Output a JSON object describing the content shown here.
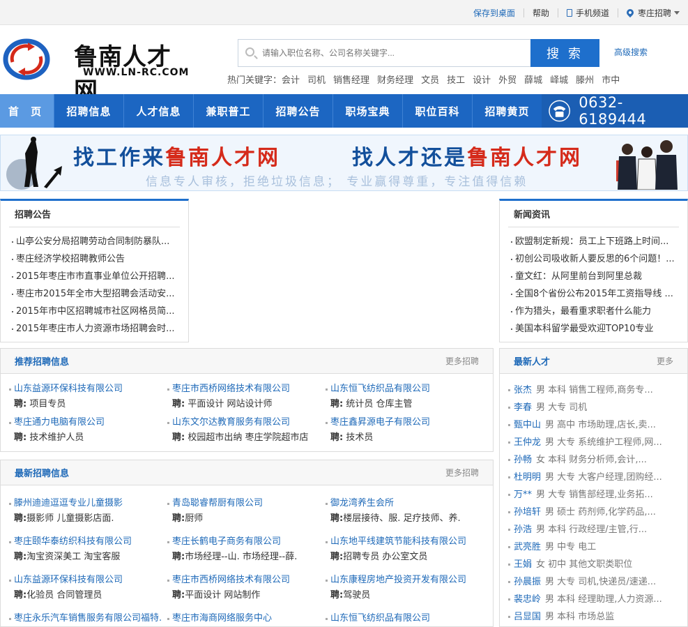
{
  "topbar": {
    "save": "保存到桌面",
    "help": "帮助",
    "mobile": "手机频道",
    "city": "枣庄招聘"
  },
  "logo": {
    "name": "鲁南人才网",
    "url": "WWW.LN-RC.COM"
  },
  "search": {
    "placeholder": "请输入职位名称、公司名称关键字...",
    "button": "搜 索",
    "advanced": "高级搜索"
  },
  "hot": {
    "label": "热门关键字：",
    "keywords": [
      "会计",
      "司机",
      "销售经理",
      "财务经理",
      "文员",
      "技工",
      "设计",
      "外贸",
      "薛城",
      "峄城",
      "滕州",
      "市中"
    ]
  },
  "nav": {
    "items": [
      "首 页",
      "招聘信息",
      "人才信息",
      "兼职普工",
      "招聘公告",
      "职场宝典",
      "职位百科",
      "招聘黄页"
    ],
    "phone": "0632-6189444"
  },
  "banner": {
    "left_a": "找工作来",
    "left_b": "鲁南人才网",
    "right_a": "找人才还是",
    "right_b": "鲁南人才网",
    "sub": "信息专人审核，拒绝垃圾信息；  专业赢得尊重，专注值得信赖"
  },
  "announce": {
    "title": "招聘公告",
    "items": [
      "山亭公安分局招聘劳动合同制防暴队...",
      "枣庄经济学校招聘教师公告",
      "2015年枣庄市市直事业单位公开招聘...",
      "枣庄市2015年全市大型招聘会活动安...",
      "2015年市中区招聘城市社区网格员简...",
      "2015年枣庄市人力资源市场招聘会时..."
    ]
  },
  "news": {
    "title": "新闻资讯",
    "items": [
      "欧盟制定新规：员工上下班路上时间...",
      "初创公司吸收新人要反思的6个问题！...",
      "童文红：从阿里前台到阿里总裁",
      "全国8个省份公布2015年工资指导线 ...",
      "作为猎头，最看重求职者什么能力",
      "美国本科留学最受欢迎TOP10专业"
    ]
  },
  "recommend": {
    "title": "推荐招聘信息",
    "more": "更多招聘",
    "jobs": [
      {
        "company": "山东益源环保科技有限公司",
        "label": "聘:",
        "positions": " 项目专员"
      },
      {
        "company": "枣庄市西桥网络技术有限公司",
        "label": "聘:",
        "positions": " 平面设计  网站设计师"
      },
      {
        "company": "山东恒飞纺织品有限公司",
        "label": "聘:",
        "positions": " 统计员  仓库主管"
      },
      {
        "company": "枣庄通力电脑有限公司",
        "label": "聘:",
        "positions": " 技术维护人员"
      },
      {
        "company": "山东文尔达教育服务有限公司",
        "label": "聘:",
        "positions": " 校园超市出纳  枣庄学院超市店"
      },
      {
        "company": "枣庄鑫昇源电子有限公司",
        "label": "聘:",
        "positions": " 技术员"
      }
    ]
  },
  "latest": {
    "title": "最新招聘信息",
    "more": "更多招聘",
    "jobs": [
      {
        "company": "滕州迪迪逗逗专业儿童摄影",
        "label": "聘:",
        "positions": "摄影师  儿童摄影店面."
      },
      {
        "company": "青岛聪睿帮厨有限公司",
        "label": "聘:",
        "positions": "厨师"
      },
      {
        "company": "御龙湾养生会所",
        "label": "聘:",
        "positions": "楼层接待、服.  足疗技师、养."
      },
      {
        "company": "枣庄颐华泰纺织科技有限公司",
        "label": "聘:",
        "positions": "淘宝资深美工  淘宝客服"
      },
      {
        "company": "枣庄长鹤电子商务有限公司",
        "label": "聘:",
        "positions": "市场经理--山.  市场经理--薛."
      },
      {
        "company": "山东地平线建筑节能科技有限公司",
        "label": "聘:",
        "positions": "招聘专员  办公室文员"
      },
      {
        "company": "山东益源环保科技有限公司",
        "label": "聘:",
        "positions": "化验员  合同管理员"
      },
      {
        "company": "枣庄市西桥网络技术有限公司",
        "label": "聘:",
        "positions": "平面设计  网站制作"
      },
      {
        "company": "山东康程房地产投资开发有限公司",
        "label": "聘:",
        "positions": "驾驶员"
      },
      {
        "company": "枣庄永乐汽车销售服务有限公司福特.",
        "label": "",
        "positions": ""
      },
      {
        "company": "枣庄市海商网络服务中心",
        "label": "",
        "positions": ""
      },
      {
        "company": "山东恒飞纺织品有限公司",
        "label": "",
        "positions": ""
      }
    ]
  },
  "talent": {
    "title": "最新人才",
    "more": "更多",
    "items": [
      {
        "name": "张杰",
        "meta": "男 本科 销售工程师,商务专..."
      },
      {
        "name": "李春",
        "meta": "男 大专 司机"
      },
      {
        "name": "甄中山",
        "meta": "男 高中 市场助理,店长,卖..."
      },
      {
        "name": "王仲龙",
        "meta": "男 大专 系统维护工程师,网..."
      },
      {
        "name": "孙畅",
        "meta": "女 本科 财务分析师,会计,..."
      },
      {
        "name": "杜明明",
        "meta": "男 大专 大客户经理,团购经..."
      },
      {
        "name": "万**",
        "meta": "男 大专 销售部经理,业务拓..."
      },
      {
        "name": "孙培轩",
        "meta": "男 硕士 药剂师,化学药品,..."
      },
      {
        "name": "孙浩",
        "meta": "男 本科 行政经理/主管,行..."
      },
      {
        "name": "武亮胜",
        "meta": "男 中专 电工"
      },
      {
        "name": "王娟",
        "meta": "女 初中 其他文职类职位"
      },
      {
        "name": "孙晨振",
        "meta": "男 大专 司机,快递员/速递..."
      },
      {
        "name": "裴忠岭",
        "meta": "男 本科 经理助理,人力资源..."
      },
      {
        "name": "吕显国",
        "meta": "男 本科 市场总监"
      }
    ]
  },
  "colors": {
    "accent": "#1e6fcc",
    "link": "#1e69b8",
    "nav": "#1c66c2",
    "red": "#d52a1a"
  }
}
